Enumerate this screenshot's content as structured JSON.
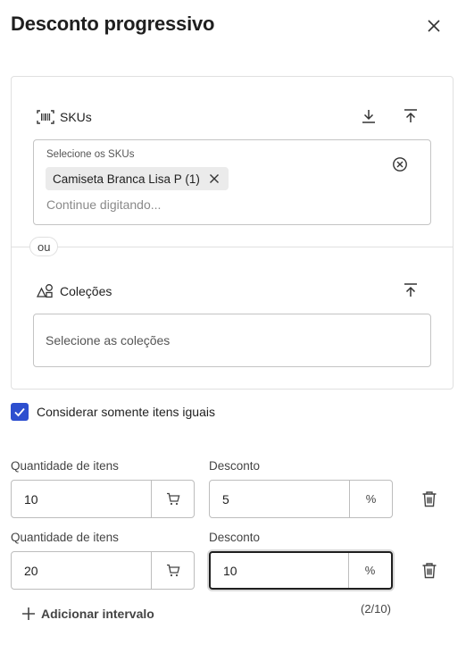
{
  "header": {
    "title": "Desconto progressivo",
    "close_icon": "close-icon"
  },
  "skus": {
    "title": "SKUs",
    "icon": "barcode-icon",
    "download_icon": "download-icon",
    "upload_icon": "upload-icon",
    "field_label": "Selecione os SKUs",
    "selected_chip": "Camiseta Branca Lisa P (1)",
    "input_placeholder": "Continue digitando..."
  },
  "separator": {
    "label": "ou"
  },
  "collections": {
    "title": "Coleções",
    "icon": "shapes-icon",
    "upload_icon": "upload-icon",
    "placeholder": "Selecione as coleções"
  },
  "option": {
    "label": "Considerar somente itens iguais",
    "checked": true
  },
  "intervals": [
    {
      "qty_label": "Quantidade de itens",
      "qty_value": "10",
      "discount_label": "Desconto",
      "discount_value": "5",
      "unit": "%"
    },
    {
      "qty_label": "Quantidade de itens",
      "qty_value": "20",
      "discount_label": "Desconto",
      "discount_value": "10",
      "unit": "%"
    }
  ],
  "footer": {
    "add_label": "Adicionar intervalo",
    "counter": "(2/10)"
  },
  "colors": {
    "accent": "#2d4fcf",
    "border": "#c4c4c4",
    "text": "#1f1f1f"
  }
}
